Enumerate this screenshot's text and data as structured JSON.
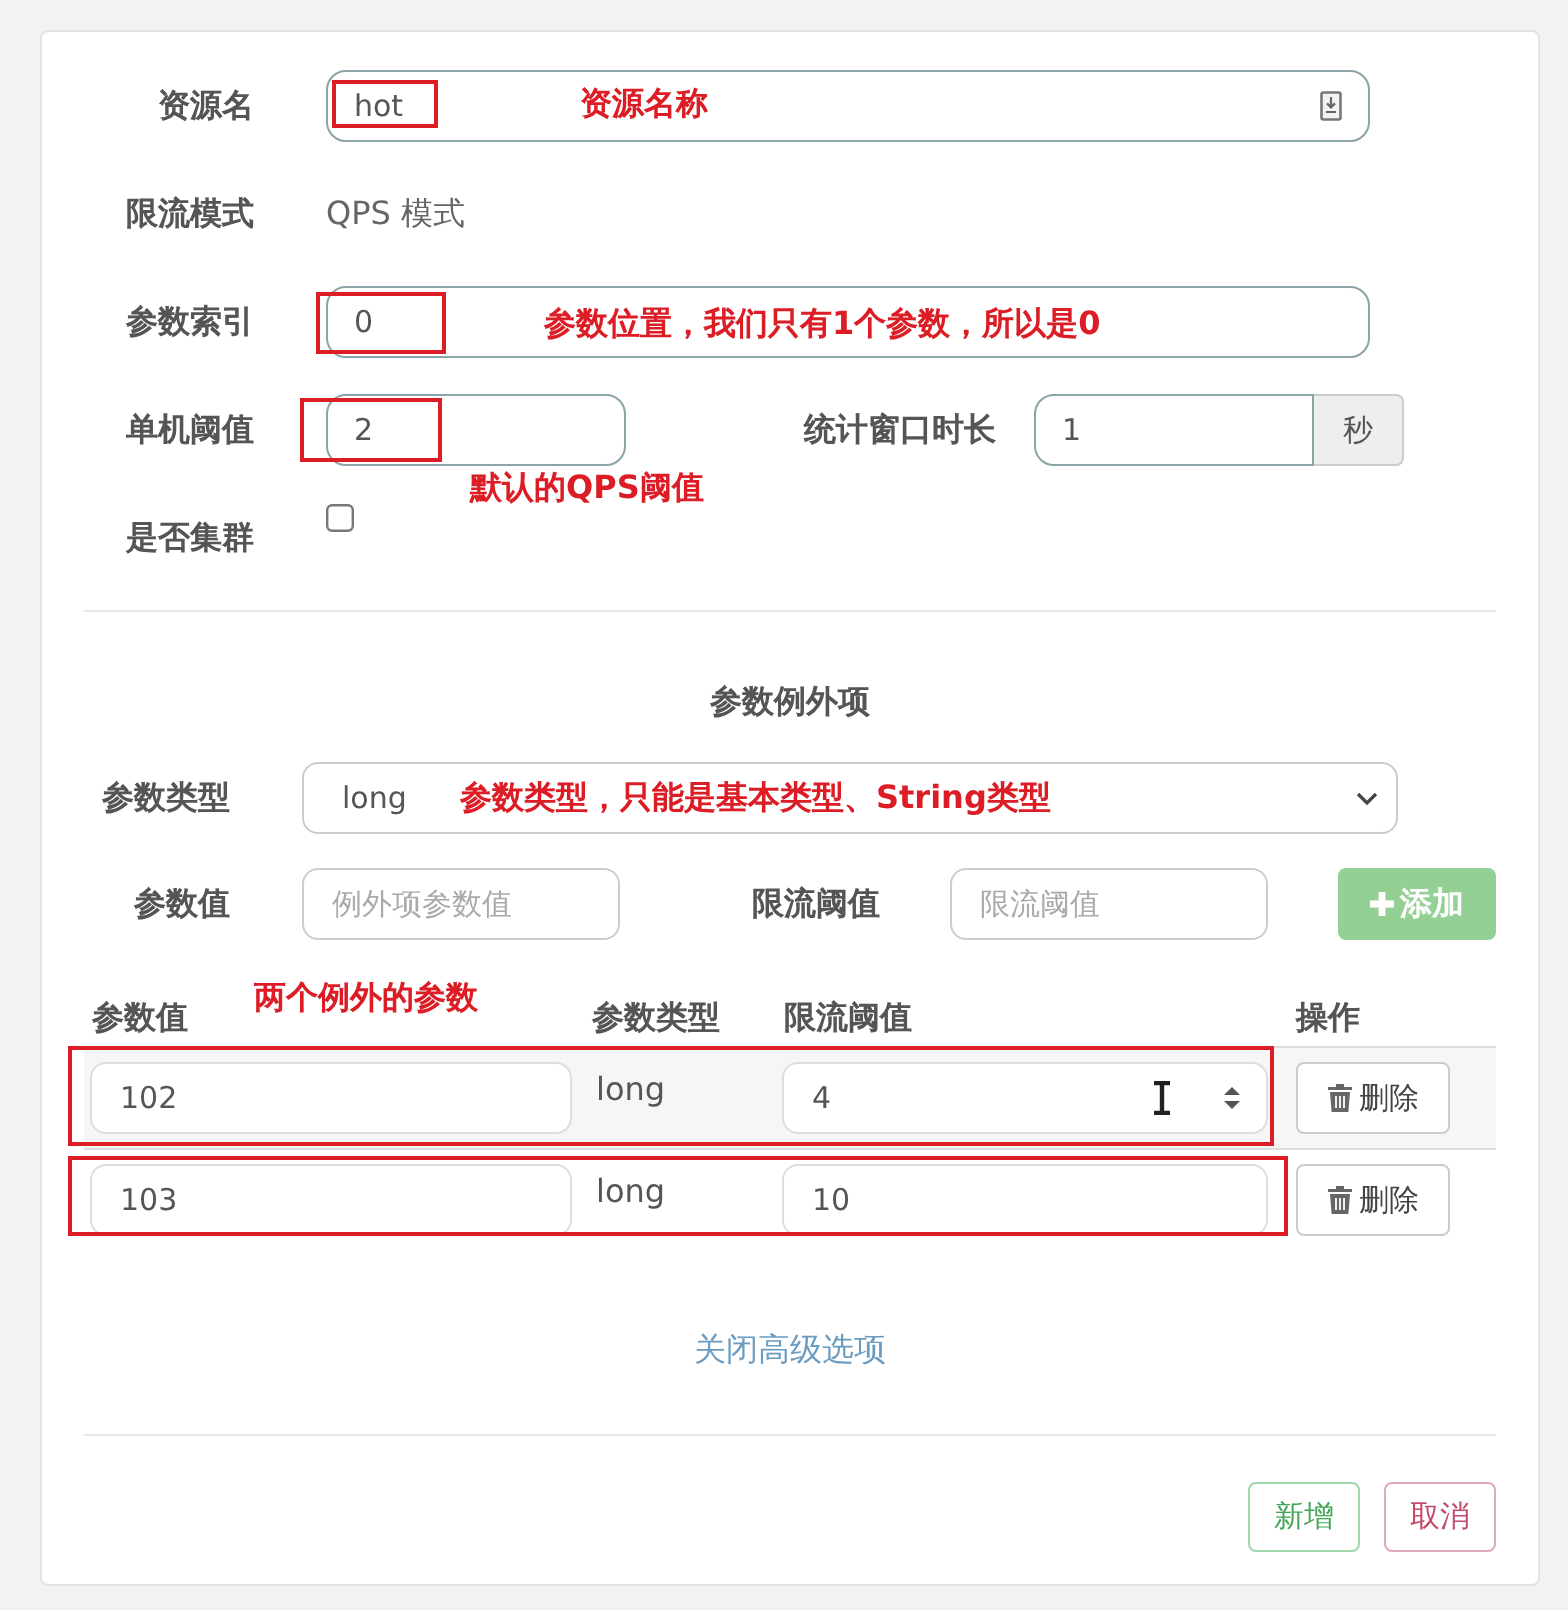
{
  "basic": {
    "resource": {
      "label": "资源名",
      "value": "hot",
      "highlighted": true,
      "annotation": "资源名称"
    },
    "mode": {
      "label": "限流模式",
      "value": "QPS 模式"
    },
    "param_index": {
      "label": "参数索引",
      "value": "0",
      "highlighted": true,
      "annotation": "参数位置，我们只有1个参数，所以是0"
    },
    "threshold": {
      "label": "单机阈值",
      "value": "2",
      "highlighted": true,
      "annotation": "默认的QPS阈值"
    },
    "window": {
      "label": "统计窗口时长",
      "value": "1",
      "unit": "秒"
    },
    "cluster": {
      "label": "是否集群",
      "checked": false
    }
  },
  "exceptions": {
    "title": "参数例外项",
    "param_type": {
      "label": "参数类型",
      "value": "long",
      "annotation": "参数类型，只能是基本类型、String类型"
    },
    "param_value": {
      "label": "参数值",
      "placeholder": "例外项参数值"
    },
    "limit": {
      "label": "限流阈值",
      "placeholder": "限流阈值"
    },
    "add_button": {
      "label": "添加",
      "disabled": true
    },
    "table": {
      "columns": [
        {
          "label": "参数值",
          "annotation": "两个例外的参数"
        },
        {
          "label": "参数类型"
        },
        {
          "label": "限流阈值"
        },
        {
          "label": "操作"
        }
      ],
      "rows": [
        {
          "value": "102",
          "type": "long",
          "limit": "4",
          "action": "删除",
          "highlighted": true,
          "hovered": true
        },
        {
          "value": "103",
          "type": "long",
          "limit": "10",
          "action": "删除",
          "highlighted": true,
          "hovered": false
        }
      ]
    }
  },
  "toggle_link": "关闭高级选项",
  "buttons": [
    {
      "kind": "add",
      "label": "新增"
    },
    {
      "kind": "cancel",
      "label": "取消"
    }
  ]
}
